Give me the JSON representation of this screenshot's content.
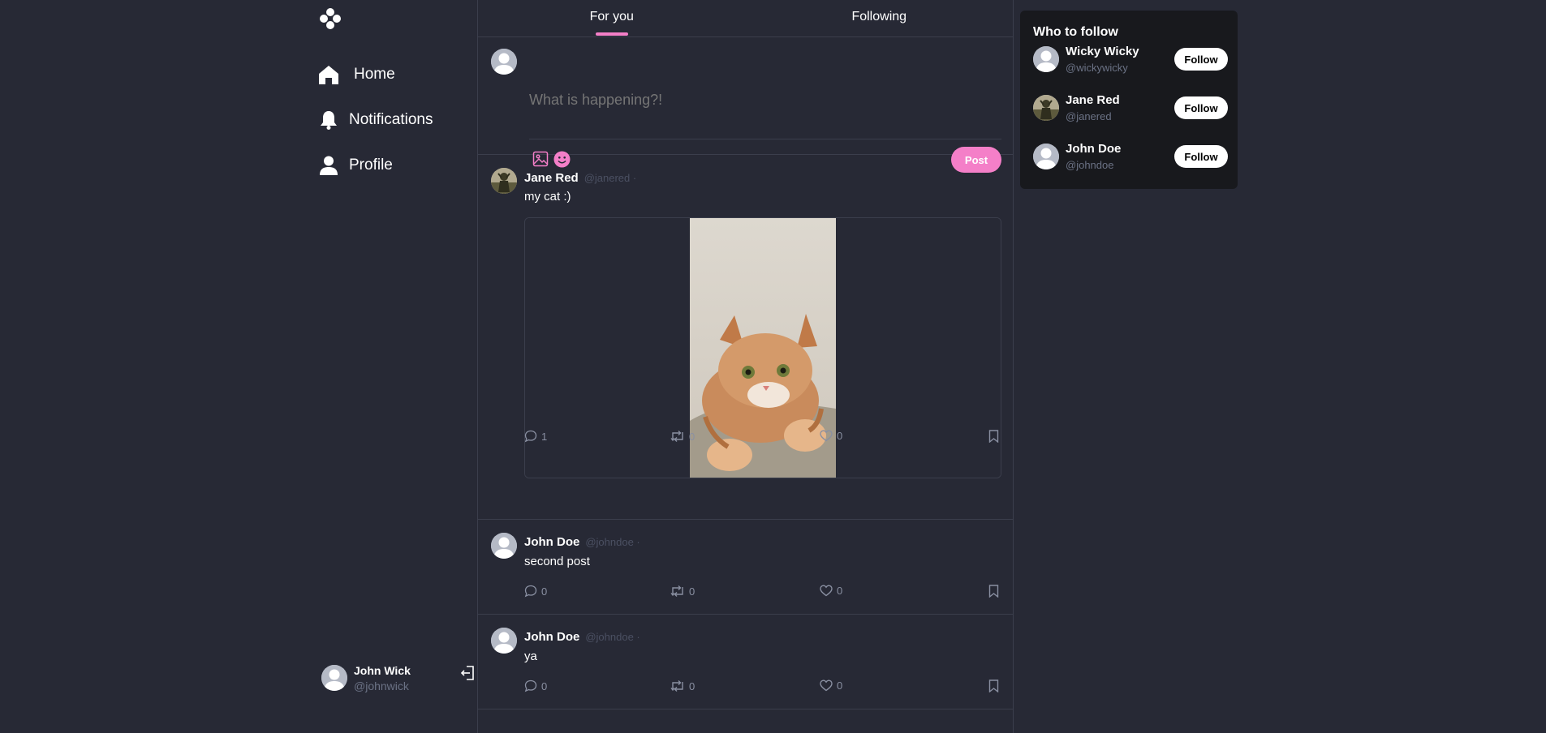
{
  "sidebar": {
    "nav": [
      {
        "label": "Home",
        "icon": "home-icon"
      },
      {
        "label": "Notifications",
        "icon": "bell-icon"
      },
      {
        "label": "Profile",
        "icon": "user-icon"
      }
    ],
    "current_user": {
      "name": "John Wick",
      "handle": "@johnwick"
    }
  },
  "tabs": [
    {
      "label": "For you",
      "active": true
    },
    {
      "label": "Following",
      "active": false
    }
  ],
  "composer": {
    "placeholder": "What is happening?!",
    "post_label": "Post"
  },
  "posts": [
    {
      "author": "Jane Red",
      "handle": "@janered ·",
      "text": "my cat :)",
      "has_image": true,
      "comments": "1",
      "reposts": "0",
      "likes": "0"
    },
    {
      "author": "John Doe",
      "handle": "@johndoe ·",
      "text": "second post",
      "has_image": false,
      "comments": "0",
      "reposts": "0",
      "likes": "0"
    },
    {
      "author": "John Doe",
      "handle": "@johndoe ·",
      "text": "ya",
      "has_image": false,
      "comments": "0",
      "reposts": "0",
      "likes": "0"
    }
  ],
  "who_to_follow": {
    "title": "Who to follow",
    "follow_label": "Follow",
    "users": [
      {
        "name": "Wicky Wicky",
        "handle": "@wickywicky"
      },
      {
        "name": "Jane Red",
        "handle": "@janered"
      },
      {
        "name": "John Doe",
        "handle": "@johndoe"
      }
    ]
  },
  "colors": {
    "accent": "#f47fc8",
    "background": "#272935",
    "panel": "#18191d",
    "border": "#3b3e4c"
  }
}
